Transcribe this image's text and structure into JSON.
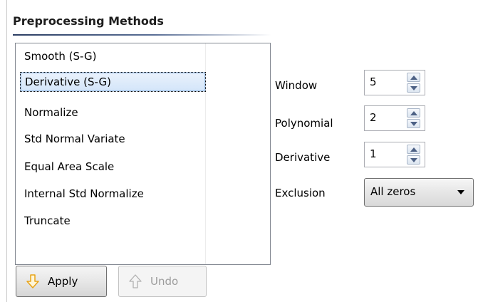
{
  "group": {
    "title": "Preprocessing Methods"
  },
  "methods": {
    "items": [
      "Smooth (S-G)",
      "Derivative (S-G)",
      "Normalize",
      "Std Normal Variate",
      "Equal Area Scale",
      "Internal Std Normalize",
      "Truncate"
    ],
    "selected": "Derivative (S-G)"
  },
  "params": {
    "window": {
      "label": "Window",
      "value": "5"
    },
    "polynomial": {
      "label": "Polynomial",
      "value": "2"
    },
    "derivative": {
      "label": "Derivative",
      "value": "1"
    },
    "exclusion": {
      "label": "Exclusion",
      "value": "All zeros"
    }
  },
  "buttons": {
    "apply": {
      "label": "Apply",
      "icon": "arrow-down-icon",
      "enabled": true
    },
    "undo": {
      "label": "Undo",
      "icon": "arrow-up-icon",
      "enabled": false
    }
  },
  "colors": {
    "selection": "#d3e5f9",
    "apply_icon": "#e8a317",
    "disabled_text": "#9c9c9c"
  }
}
